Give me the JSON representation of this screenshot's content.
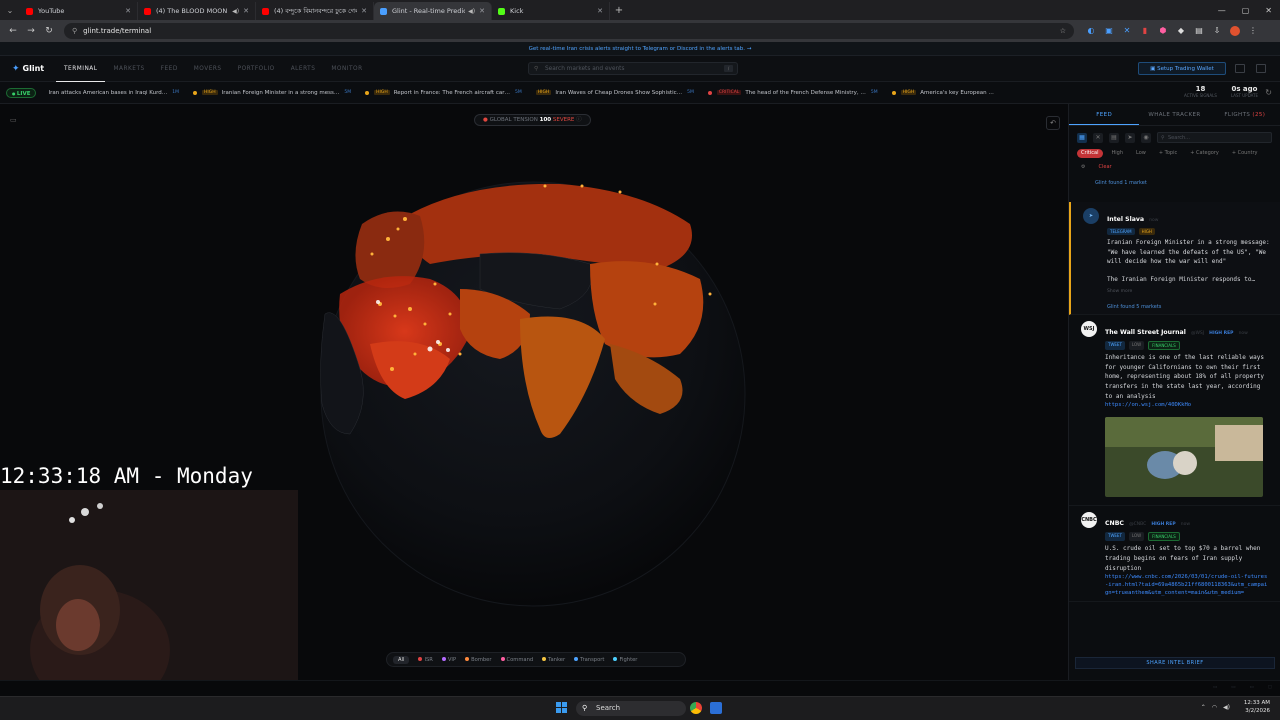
{
  "browser": {
    "tabs": [
      {
        "title": "YouTube",
        "color": "#ff0000",
        "active": false,
        "audio": false
      },
      {
        "title": "(4) The BLOOD MOON Prop",
        "color": "#ff0000",
        "active": false,
        "audio": true
      },
      {
        "title": "(4) বন্দুকে বিমানবন্দরে ঢুকে গেল মা",
        "color": "#ff0000",
        "active": false,
        "audio": false
      },
      {
        "title": "Glint - Real-time Prediction",
        "color": "#4a9fff",
        "active": true,
        "audio": true
      },
      {
        "title": "Kick",
        "color": "#53fc18",
        "active": false,
        "audio": false
      }
    ],
    "url": "glint.trade/terminal"
  },
  "banner": {
    "text": "Get real-time Iran crisis alerts straight to Telegram or Discord in the alerts tab. →"
  },
  "nav": {
    "logo": "Glint",
    "items": [
      {
        "label": "TERMINAL",
        "active": true
      },
      {
        "label": "MARKETS",
        "active": false
      },
      {
        "label": "FEED",
        "active": false
      },
      {
        "label": "MOVERS",
        "active": false
      },
      {
        "label": "PORTFOLIO",
        "active": false
      },
      {
        "label": "ALERTS",
        "active": false
      },
      {
        "label": "MONITOR",
        "active": false
      }
    ],
    "search_placeholder": "Search markets and events",
    "search_kbd": "/",
    "wallet_button": "Setup Trading Wallet"
  },
  "ticker": {
    "live": "LIVE",
    "items": [
      {
        "text": "Iran attacks American bases in Iraqi Kurd…",
        "ago": "1M",
        "badge": "",
        "dot": "#6b6f77"
      },
      {
        "text": "Iranian Foreign Minister in a strong mess…",
        "ago": "5M",
        "badge": "HIGH",
        "dot": "#e8a51a"
      },
      {
        "text": "Report in France: The French aircraft car…",
        "ago": "5M",
        "badge": "HIGH",
        "dot": "#e8a51a"
      },
      {
        "text": "Iran Waves of Cheap Drones Show Sophistic…",
        "ago": "5M",
        "badge": "HIGH",
        "dot": "#e8a51a"
      },
      {
        "text": "The head of the French Defense Ministry, …",
        "ago": "5M",
        "badge": "CRITICAL",
        "dot": "#e04343"
      },
      {
        "text": "America's key European …",
        "ago": "",
        "badge": "HIGH",
        "dot": "#e8a51a"
      }
    ],
    "stats": [
      {
        "value": "18",
        "label": "ACTIVE SIGNALS"
      },
      {
        "value": "0s ago",
        "label": "LAST UPDATE"
      }
    ]
  },
  "map": {
    "tension_label": "GLOBAL TENSION",
    "tension_value": "100",
    "tension_level": "SEVERE",
    "clock": "12:33:18 AM - Monday",
    "legend": [
      {
        "label": "All",
        "color": ""
      },
      {
        "label": "ISR",
        "color": "#e04343"
      },
      {
        "label": "VIP",
        "color": "#b46bff"
      },
      {
        "label": "Bomber",
        "color": "#ff8a3d"
      },
      {
        "label": "Command",
        "color": "#ff5fa2"
      },
      {
        "label": "Tanker",
        "color": "#f5c542"
      },
      {
        "label": "Transport",
        "color": "#4da3ff"
      },
      {
        "label": "Fighter",
        "color": "#4dd0ff"
      }
    ]
  },
  "panel": {
    "tabs": [
      {
        "label": "FEED",
        "active": true,
        "count": ""
      },
      {
        "label": "WHALE TRACKER",
        "active": false,
        "count": ""
      },
      {
        "label": "FLIGHTS",
        "active": false,
        "count": "(25)"
      }
    ],
    "search_placeholder": "Search...",
    "chips": [
      "Critical",
      "High",
      "Low",
      "+ Topic",
      "+ Category",
      "+ Country",
      "Clear"
    ],
    "found_top": "Glint found 1 market",
    "posts": [
      {
        "name": "Intel Slava",
        "handle": "now",
        "rep": "",
        "badges": [
          "TELEGRAM",
          "HIGH"
        ],
        "body": "Iranian Foreign Minister in a strong message: \"We have learned the defeats of the US\", \"We will decide how the war will end\"",
        "body2": "The Iranian Foreign Minister responds to…",
        "more": "Show more",
        "found": "Glint found 5 markets"
      },
      {
        "name": "The Wall Street Journal",
        "handle": "@WSJ",
        "rep": "HIGH REP",
        "time": "now",
        "badges": [
          "TWEET",
          "LOW",
          "FINANCIALS"
        ],
        "body": "Inheritance is one of the last reliable ways for younger Californians to own their first home, representing about 18% of all property transfers in the state last year, according to an analysis",
        "link": "https://on.wsj.com/40DKkHo"
      },
      {
        "name": "CNBC",
        "handle": "@CNBC",
        "rep": "HIGH REP",
        "time": "now",
        "badges": [
          "TWEET",
          "LOW",
          "FINANCIALS"
        ],
        "body": "U.S. crude oil set to top $70 a barrel when trading begins on fears of Iran supply disruption",
        "link": "https://www.cnbc.com/2026/03/01/crude-oil-futures-iran.html?taid=69a4865b21ff6800118363&utm_campaign=trueanthem&utm_content=main&utm_medium="
      }
    ],
    "brief_button": "SHARE INTEL BRIEF"
  },
  "taskbar": {
    "search": "Search",
    "time": "12:33 AM",
    "date": "3/2/2026"
  }
}
